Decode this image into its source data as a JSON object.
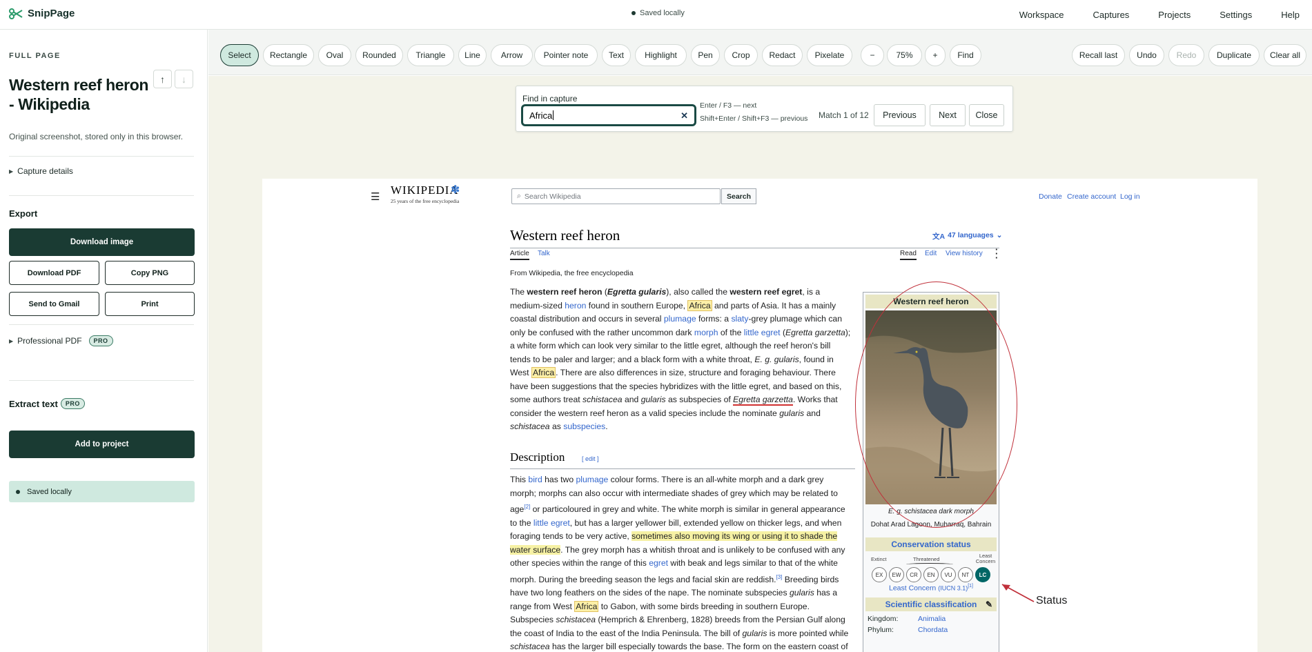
{
  "app": {
    "name": "SnipPage",
    "status": "Saved locally"
  },
  "nav": [
    "Workspace",
    "Captures",
    "Projects",
    "Settings",
    "Help"
  ],
  "sidebar": {
    "label": "FULL PAGE",
    "title": "Western reef heron - Wikipedia",
    "subtitle": "Original screenshot, stored only in this browser.",
    "capture_details": "Capture details",
    "export_heading": "Export",
    "download_image": "Download image",
    "download_pdf": "Download PDF",
    "copy_png": "Copy PNG",
    "send_gmail": "Send to Gmail",
    "print": "Print",
    "professional_pdf": "Professional PDF",
    "pro_badge": "PRO",
    "extract_text": "Extract text",
    "add_to_project": "Add to project",
    "saved": "Saved locally"
  },
  "toolbar": {
    "tools": [
      "Select",
      "Rectangle",
      "Oval",
      "Rounded",
      "Triangle",
      "Line",
      "Arrow",
      "Pointer note",
      "Text",
      "Highlight",
      "Pen",
      "Crop",
      "Redact",
      "Pixelate"
    ],
    "zoom_out": "−",
    "zoom": "75%",
    "zoom_in": "+",
    "find": "Find",
    "recall_last": "Recall last",
    "undo": "Undo",
    "redo": "Redo",
    "duplicate": "Duplicate",
    "clear_all": "Clear all"
  },
  "find": {
    "label": "Find in capture",
    "query": "Africa",
    "hint_next": "Enter / F3 — next",
    "hint_prev": "Shift+Enter / Shift+F3 — previous",
    "match": "Match 1 of 12",
    "previous": "Previous",
    "next": "Next",
    "close": "Close"
  },
  "wiki": {
    "logo": "WIKIPEDIA",
    "logo_sub": "25 years of the free encyclopedia",
    "search_placeholder": "Search Wikipedia",
    "search_btn": "Search",
    "donate": "Donate",
    "create_account": "Create account",
    "log_in": "Log in",
    "title": "Western reef heron",
    "languages": "47 languages",
    "tab_article": "Article",
    "tab_talk": "Talk",
    "tab_read": "Read",
    "tab_edit": "Edit",
    "tab_history": "View history",
    "from": "From Wikipedia, the free encyclopedia",
    "desc_heading": "Description",
    "desc_edit": "[ edit ]",
    "infobox": {
      "title": "Western reef heron",
      "caption_1": "E. g. schistacea dark morph",
      "caption_2": "Dohat Arad Lagoon, Muharraq, Bahrain",
      "conservation": "Conservation status",
      "extinct": "Extinct",
      "threatened": "Threatened",
      "least": "Least Concern",
      "codes": [
        "EX",
        "EW",
        "CR",
        "EN",
        "VU",
        "NT",
        "LC"
      ],
      "status_link": "Least Concern",
      "iucn": "(IUCN 3.1)",
      "scientific": "Scientific classification",
      "kingdom_lbl": "Kingdom:",
      "kingdom": "Animalia",
      "phylum_lbl": "Phylum:",
      "phylum": "Chordata"
    },
    "annotation": "Status"
  }
}
